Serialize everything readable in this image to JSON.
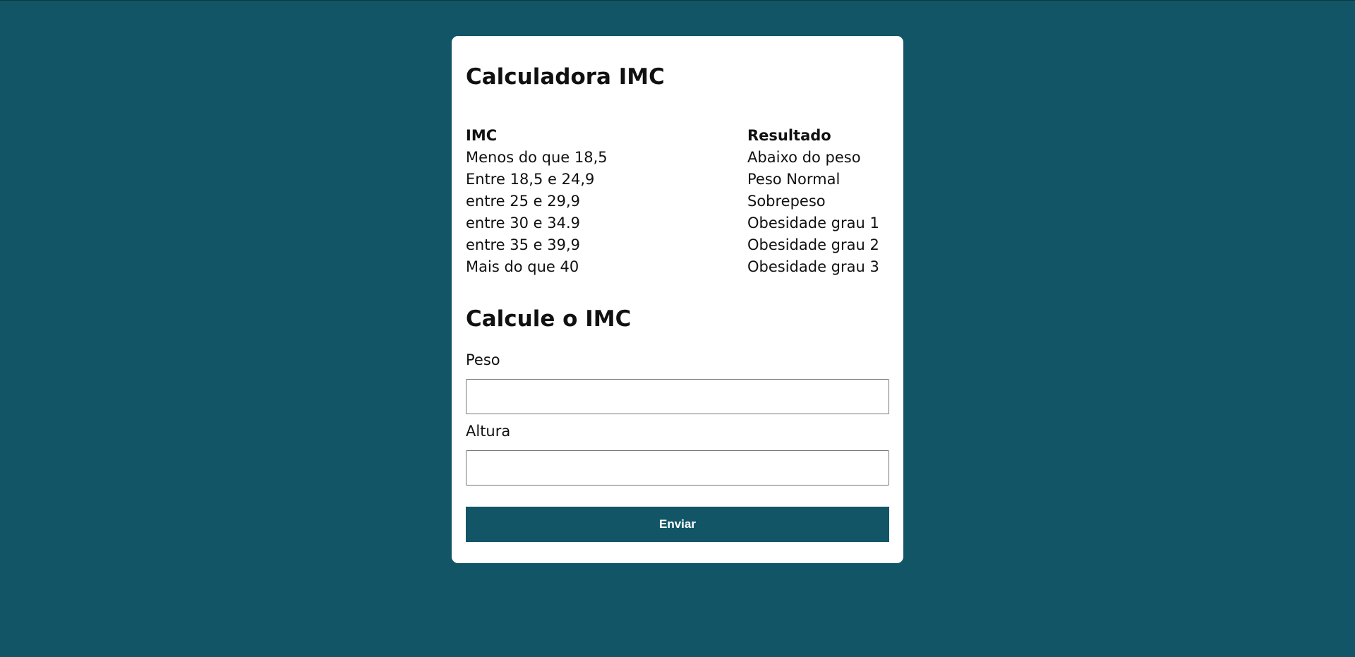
{
  "card": {
    "title": "Calculadora IMC",
    "table": {
      "headers": [
        "IMC",
        "Resultado"
      ],
      "rows": [
        [
          "Menos do que 18,5",
          "Abaixo do peso"
        ],
        [
          "Entre 18,5 e 24,9",
          "Peso Normal"
        ],
        [
          "entre 25 e 29,9",
          "Sobrepeso"
        ],
        [
          "entre 30 e 34.9",
          "Obesidade grau 1"
        ],
        [
          "entre 35 e 39,9",
          "Obesidade grau 2"
        ],
        [
          "Mais do que 40",
          "Obesidade grau 3"
        ]
      ]
    },
    "form": {
      "title": "Calcule o IMC",
      "peso_label": "Peso",
      "peso_value": "",
      "altura_label": "Altura",
      "altura_value": "",
      "submit_label": "Enviar"
    }
  },
  "colors": {
    "background": "#125566",
    "button": "#125566",
    "card": "#ffffff"
  }
}
